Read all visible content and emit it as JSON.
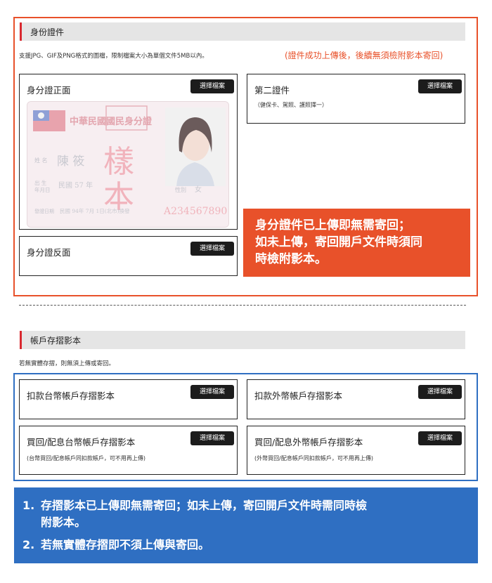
{
  "id_section": {
    "title": "身份證件",
    "note": "支援JPG、GIF及PNG格式的圖檔，限制檔案大小為單個文件5MB以內。",
    "note_red": "(證件成功上傳後，後續無須檢附影本寄回)",
    "front": {
      "title": "身分證正面",
      "button": "選擇檔案"
    },
    "back": {
      "title": "身分證反面",
      "button": "選擇檔案"
    },
    "second": {
      "title": "第二證件",
      "subtitle": "（健保卡、駕照、護照擇一）",
      "button": "選擇檔案"
    },
    "id_image": {
      "header": "中華民國國民身分證",
      "name_label": "姓 名",
      "name": "陳 筱",
      "birth_label": "出 生\n年月日",
      "birth": "民國 57 年",
      "gender_label": "性別",
      "gender": "女",
      "issue_label": "發證日期",
      "issue": "民國 94年 7月 1日(北市)換發",
      "number": "A234567890",
      "watermark": "樣本"
    },
    "orange_notice": [
      "身分證件已上傳即無需寄回；",
      "如未上傳，寄回開戶文件時須同",
      "時檢附影本。"
    ]
  },
  "account_section": {
    "title": "帳戶存摺影本",
    "note": "若無實體存摺，則無須上傳或寄回。",
    "cards": [
      {
        "title": "扣款台幣帳戶存摺影本",
        "subtitle": "",
        "button": "選擇檔案"
      },
      {
        "title": "扣款外幣帳戶存摺影本",
        "subtitle": "",
        "button": "選擇檔案"
      },
      {
        "title": "買回/配息台幣帳戶存摺影本",
        "subtitle": "(台幣買回/配息帳戶同扣款帳戶，可不用再上傳)",
        "button": "選擇檔案"
      },
      {
        "title": "買回/配息外幣帳戶存摺影本",
        "subtitle": "(外幣買回/配息帳戶同扣款帳戶，可不用再上傳)",
        "button": "選擇檔案"
      }
    ],
    "blue_notice": {
      "item1_num": "1.",
      "item1_line1": "存摺影本已上傳即無需寄回；如未上傳，寄回開戶文件時需同時檢",
      "item1_line2": "附影本。",
      "item2_num": "2.",
      "item2": "若無實體存摺即不須上傳與寄回。"
    }
  },
  "colors": {
    "orange": "#e8512a",
    "blue": "#2f6fc2",
    "red_bar": "#d9282f",
    "button": "#1c1c1c"
  }
}
